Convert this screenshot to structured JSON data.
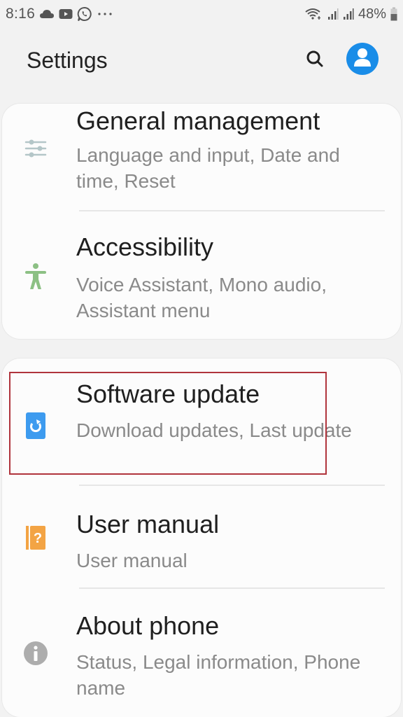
{
  "status_bar": {
    "time": "8:16",
    "left_icons": [
      "cloud-icon",
      "youtube-icon",
      "whatsapp-icon",
      "more-notifications-icon"
    ],
    "right_icons": [
      "wifi-icon",
      "signal-1-icon",
      "signal-2-icon"
    ],
    "battery_percent": "48%",
    "battery_icon": "battery-icon"
  },
  "header": {
    "title": "Settings",
    "search_icon": "search-icon",
    "account_icon": "account-icon",
    "accent_color": "#1a8de8"
  },
  "groups": [
    {
      "items": [
        {
          "title": "General management",
          "subtitle": "Language and input, Date and time, Reset",
          "icon": "sliders-icon",
          "icon_color": "#b4c6c8"
        },
        {
          "title": "Accessibility",
          "subtitle": "Voice Assistant, Mono audio, Assistant menu",
          "icon": "accessibility-icon",
          "icon_color": "#8cc084"
        }
      ]
    },
    {
      "items": [
        {
          "title": "Software update",
          "subtitle": "Download updates, Last update",
          "icon": "software-update-icon",
          "icon_color": "#3d9bef",
          "highlighted": true,
          "highlight_color": "#b0343c"
        },
        {
          "title": "User manual",
          "subtitle": "User manual",
          "icon": "user-manual-icon",
          "icon_color": "#f3a444"
        },
        {
          "title": "About phone",
          "subtitle": "Status, Legal information, Phone name",
          "icon": "info-icon",
          "icon_color": "#adadad"
        }
      ]
    }
  ]
}
